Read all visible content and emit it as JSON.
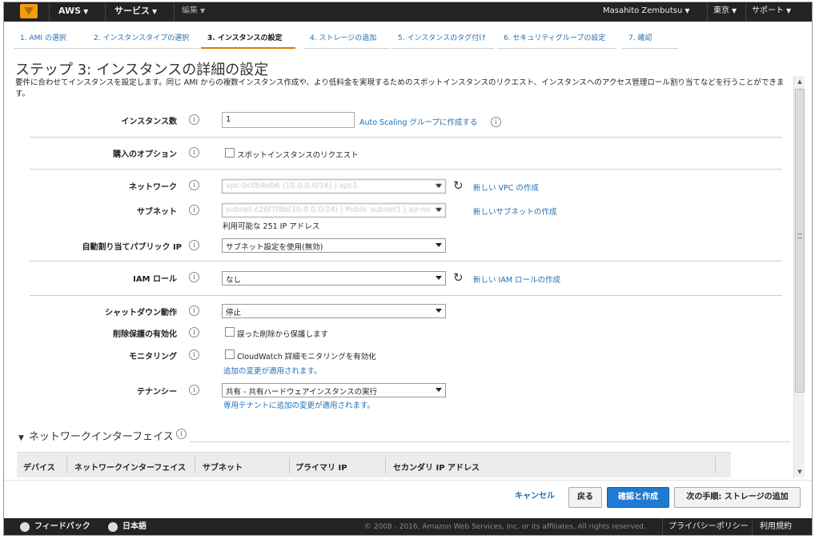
{
  "topbar": {
    "aws": "AWS",
    "services": "サービス",
    "edit": "編集",
    "user": "Masahito Zembutsu",
    "region": "東京",
    "support": "サポート"
  },
  "steps": [
    {
      "label": "1. AMI の選択"
    },
    {
      "label": "2. インスタンスタイプの選択"
    },
    {
      "label": "3. インスタンスの設定"
    },
    {
      "label": "4. ストレージの追加"
    },
    {
      "label": "5. インスタンスのタグ付け"
    },
    {
      "label": "6. セキュリティグループの設定"
    },
    {
      "label": "7. 確認"
    }
  ],
  "page": {
    "title": "ステップ 3: インスタンスの詳細の設定",
    "description": "要件に合わせてインスタンスを設定します。同じ AMI からの複数インスタンス作成や、より低料金を実現するためのスポットインスタンスのリクエスト、インスタンスへのアクセス管理ロール割り当てなどを行うことができます。"
  },
  "form": {
    "instances": {
      "label": "インスタンス数",
      "value": "1",
      "link": "Auto Scaling グループに作成する"
    },
    "purchase": {
      "label": "購入のオプション",
      "checkbox_label": "スポットインスタンスのリクエスト"
    },
    "network": {
      "label": "ネットワーク",
      "value": "vpc-0c0b4eb6 (10.0.0.0/16) | vpc1",
      "link": "新しい VPC の作成"
    },
    "subnet": {
      "label": "サブネット",
      "value": "subnet-c26f7f8b(10.0.0.0/24) | Public subnet1 | ap-no",
      "available": "利用可能な 251 IP アドレス",
      "link": "新しいサブネットの作成"
    },
    "public_ip": {
      "label": "自動割り当てパブリック IP",
      "value": "サブネット設定を使用(無効)"
    },
    "iam": {
      "label": "IAM ロール",
      "value": "なし",
      "link": "新しい IAM ロールの作成"
    },
    "shutdown": {
      "label": "シャットダウン動作",
      "value": "停止"
    },
    "termination": {
      "label": "削除保護の有効化",
      "checkbox_label": "誤った削除から保護します"
    },
    "monitoring": {
      "label": "モニタリング",
      "checkbox_label": "CloudWatch 詳細モニタリングを有効化",
      "note": "追加の変更が適用されます。"
    },
    "tenancy": {
      "label": "テナンシー",
      "value": "共有 - 共有ハードウェアインスタンスの実行",
      "note": "専用テナントに追加の変更が適用されます。"
    }
  },
  "nic": {
    "header": "ネットワークインターフェイス",
    "columns": [
      "デバイス",
      "ネットワークインターフェイス",
      "サブネット",
      "プライマリ IP",
      "セカンダリ IP アドレス"
    ]
  },
  "actions": {
    "cancel": "キャンセル",
    "back": "戻る",
    "review": "確認と作成",
    "next": "次の手順: ストレージの追加"
  },
  "footer": {
    "feedback": "フィードバック",
    "language": "日本語",
    "copyright": "© 2008 - 2016, Amazon Web Services, Inc. or its affiliates. All rights reserved.",
    "privacy": "プライバシーポリシー",
    "terms": "利用規約"
  },
  "colors": {
    "accent": "#e07b00",
    "link": "#1f6fb5",
    "primary_button": "#1f7ad1",
    "topbar": "#232323"
  }
}
